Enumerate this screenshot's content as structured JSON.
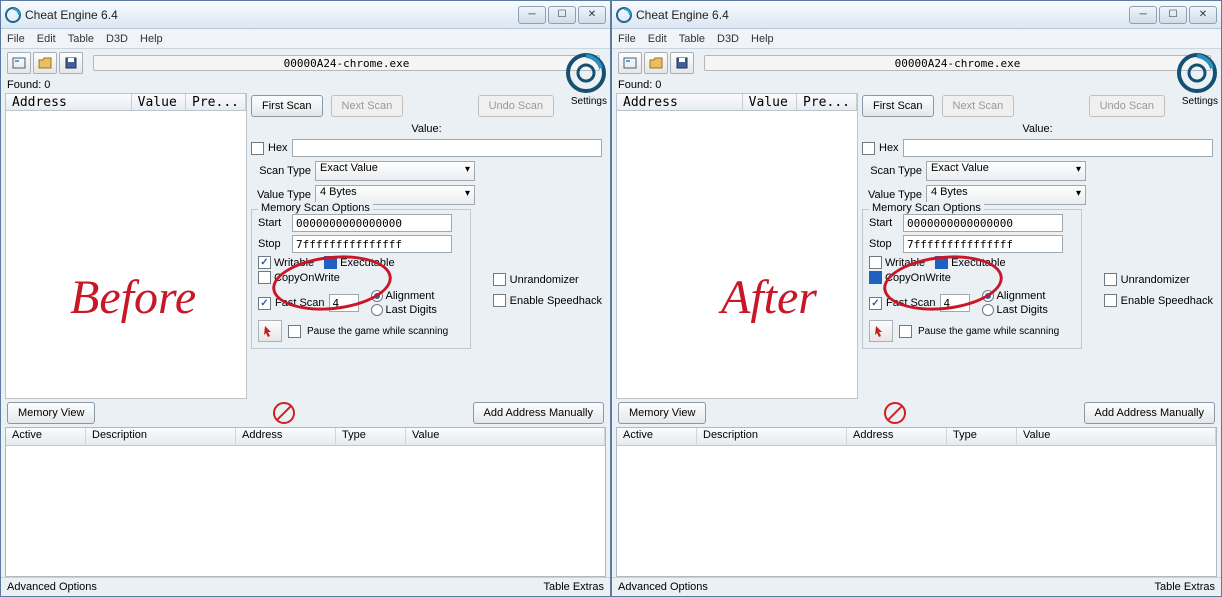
{
  "app": {
    "title": "Cheat Engine 6.4",
    "menu": [
      "File",
      "Edit",
      "Table",
      "D3D",
      "Help"
    ],
    "process": "00000A24-chrome.exe",
    "settings_label": "Settings",
    "found_label": "Found: 0"
  },
  "results": {
    "cols": [
      "Address",
      "Value",
      "Pre..."
    ]
  },
  "scan": {
    "first": "First Scan",
    "next": "Next Scan",
    "undo": "Undo Scan",
    "value_label": "Value:",
    "hex_label": "Hex",
    "scan_type_label": "Scan Type",
    "scan_type": "Exact Value",
    "value_type_label": "Value Type",
    "value_type": "4 Bytes"
  },
  "mem": {
    "group": "Memory Scan Options",
    "start_label": "Start",
    "start": "0000000000000000",
    "stop_label": "Stop",
    "stop": "7fffffffffffffff",
    "writable": "Writable",
    "executable": "Executable",
    "cow": "CopyOnWrite",
    "fast": "Fast Scan",
    "fast_val": "4",
    "alignment": "Alignment",
    "last_digits": "Last Digits",
    "pause": "Pause the game while scanning"
  },
  "extra": {
    "unrandomizer": "Unrandomizer",
    "speedhack": "Enable Speedhack"
  },
  "buttons": {
    "memview": "Memory View",
    "add_manual": "Add Address Manually"
  },
  "table": {
    "cols": [
      "Active",
      "Description",
      "Address",
      "Type",
      "Value"
    ]
  },
  "status": {
    "left": "Advanced Options",
    "right": "Table Extras"
  },
  "before": {
    "label": "Before",
    "writable_checked": true,
    "cow_checked": false,
    "cow_filled": false
  },
  "after": {
    "label": "After",
    "writable_checked": false,
    "cow_checked": false,
    "cow_filled": true
  }
}
